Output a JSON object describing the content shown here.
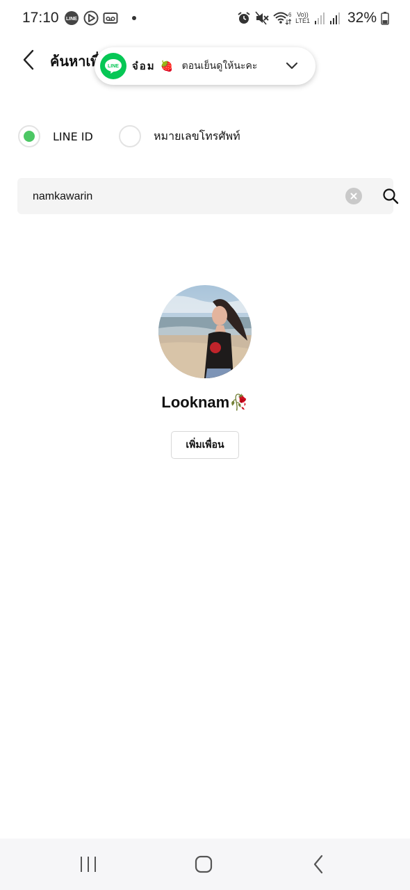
{
  "status_bar": {
    "time": "17:10",
    "battery_percent": "32%",
    "left_icons": [
      "line-notification-icon",
      "play-store-icon",
      "voicemail-icon"
    ],
    "right_icons": [
      "alarm-icon",
      "mute-icon",
      "wifi-icon",
      "volte-icon",
      "signal-icon",
      "signal-icon",
      "battery-icon"
    ],
    "network_label_top": "Vo))",
    "network_label_bottom": "LTE1"
  },
  "header": {
    "title": "ค้นหาเพื่อน"
  },
  "notification": {
    "app": "LINE",
    "sender": "จ๋อม",
    "sender_emoji": "🍓",
    "message": "ตอนเย็นดูให้นะคะ",
    "brand_color": "#06c755"
  },
  "search_type": {
    "options": [
      {
        "label": "LINE ID",
        "selected": true
      },
      {
        "label": "หมายเลขโทรศัพท์",
        "selected": false
      }
    ],
    "accent": "#4cc764"
  },
  "search": {
    "value": "namkawarin",
    "placeholder": ""
  },
  "result": {
    "display_name": "Looknam🥀",
    "add_button_label": "เพิ่มเพื่อน"
  },
  "nav_bar": {
    "buttons": [
      "recent-apps-icon",
      "home-icon",
      "back-icon"
    ]
  }
}
